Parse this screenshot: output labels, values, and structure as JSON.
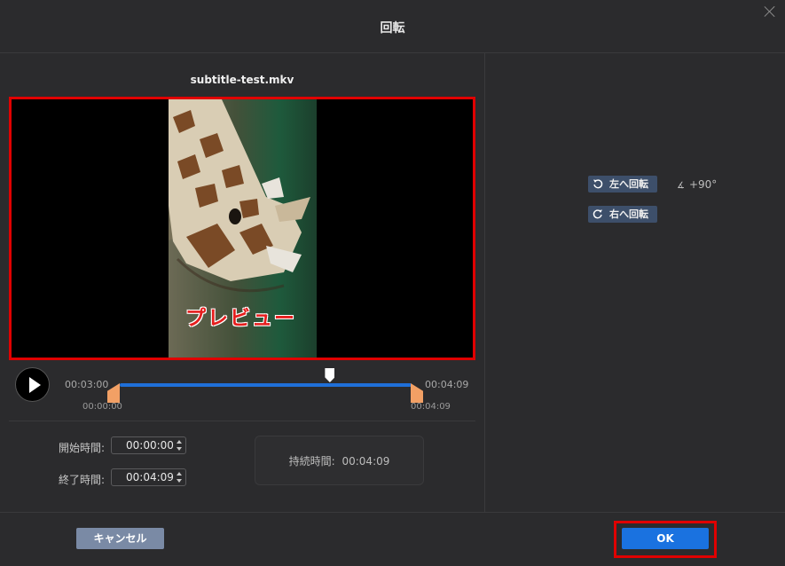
{
  "dialog": {
    "title": "回転"
  },
  "preview": {
    "filename": "subtitle-test.mkv",
    "overlay_label": "プレビュー"
  },
  "timeline": {
    "current_time": "00:03:00",
    "end_time": "00:04:09",
    "range_start": "00:00:00",
    "range_end": "00:04:09",
    "playhead_fraction": 0.72
  },
  "trim": {
    "start_label": "開始時間:",
    "start_value": "00:00:00",
    "end_label": "終了時間:",
    "end_value": "00:04:09",
    "duration_label": "持続時間:",
    "duration_value": "00:04:09"
  },
  "rotation": {
    "rotate_left_label": "左へ回転",
    "rotate_right_label": "右へ回転",
    "angle_value": "+90°"
  },
  "footer": {
    "cancel_label": "キャンセル",
    "ok_label": "OK"
  },
  "colors": {
    "accent": "#1a72e0",
    "highlight": "#e00000",
    "trim_handle": "#f2a065",
    "rotate_button": "#3d4f6a"
  }
}
